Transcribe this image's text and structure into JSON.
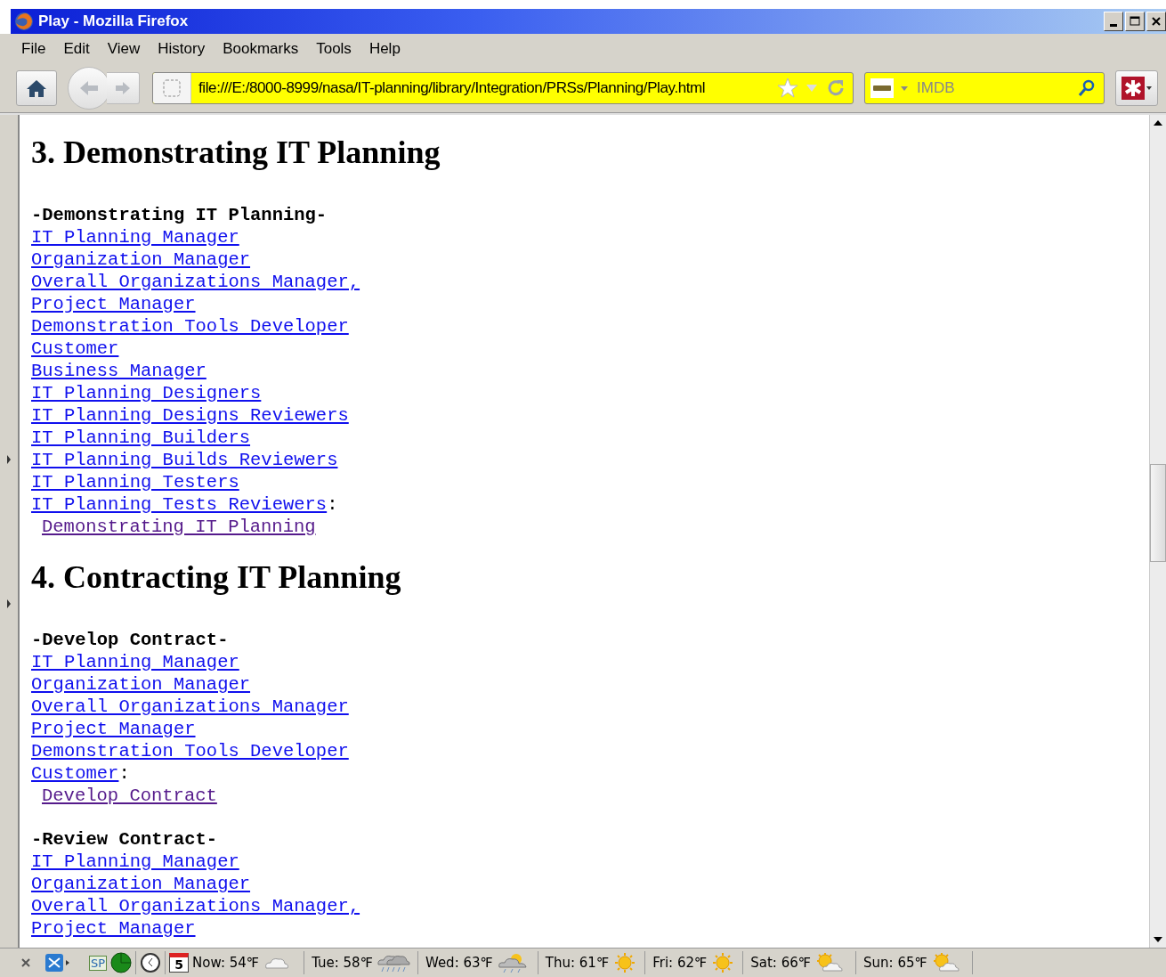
{
  "window": {
    "title": "Play - Mozilla Firefox"
  },
  "menu": [
    "File",
    "Edit",
    "View",
    "History",
    "Bookmarks",
    "Tools",
    "Help"
  ],
  "address_bar": {
    "value": "file:///E:/8000-8999/nasa/IT-planning/library/Integration/PRSs/Planning/Play.html"
  },
  "search_bar": {
    "placeholder": "IMDB"
  },
  "sections": [
    {
      "heading": "3. Demonstrating IT Planning",
      "groups": [
        {
          "title": "-Demonstrating IT Planning-",
          "roles": [
            {
              "text": "IT Planning Manager",
              "visited": false
            },
            {
              "text": "Organization Manager",
              "visited": false
            },
            {
              "text": "Overall Organizations Manager,",
              "visited": false
            },
            {
              "text": "Project Manager",
              "visited": false
            },
            {
              "text": "Demonstration Tools Developer",
              "visited": false
            },
            {
              "text": "Customer",
              "visited": false
            },
            {
              "text": "Business Manager",
              "visited": false
            },
            {
              "text": "IT Planning Designers",
              "visited": false
            },
            {
              "text": "IT Planning Designs Reviewers",
              "visited": false
            },
            {
              "text": "IT Planning Builders",
              "visited": false
            },
            {
              "text": "IT Planning Builds Reviewers",
              "visited": false
            },
            {
              "text": "IT Planning Testers",
              "visited": false
            },
            {
              "text": "IT Planning Tests Reviewers",
              "visited": false
            }
          ],
          "suffix": ":",
          "action": {
            "text": "Demonstrating IT Planning",
            "visited": true
          }
        }
      ]
    },
    {
      "heading": "4. Contracting IT Planning",
      "groups": [
        {
          "title": "-Develop Contract-",
          "roles": [
            {
              "text": "IT Planning Manager",
              "visited": false
            },
            {
              "text": "Organization Manager",
              "visited": false
            },
            {
              "text": "Overall Organizations Manager",
              "visited": false
            },
            {
              "text": "Project Manager",
              "visited": false
            },
            {
              "text": "Demonstration Tools Developer",
              "visited": false
            },
            {
              "text": "Customer",
              "visited": false
            }
          ],
          "suffix": ":",
          "action": {
            "text": "Develop Contract",
            "visited": true
          }
        },
        {
          "title": "-Review Contract-",
          "roles": [
            {
              "text": "IT Planning Manager",
              "visited": false
            },
            {
              "text": "Organization Manager",
              "visited": false
            },
            {
              "text": "Overall Organizations Manager,",
              "visited": false
            },
            {
              "text": "Project Manager",
              "visited": false
            }
          ]
        }
      ]
    }
  ],
  "status_bar": {
    "calendar_day": "5",
    "sp_label": "SP",
    "weather": [
      {
        "label": "Now: 54℉",
        "kind": "cloudy"
      },
      {
        "label": "Tue: 58℉",
        "kind": "rain"
      },
      {
        "label": "Wed: 63℉",
        "kind": "sun-rain"
      },
      {
        "label": "Thu: 61℉",
        "kind": "sunny"
      },
      {
        "label": "Fri: 62℉",
        "kind": "sunny"
      },
      {
        "label": "Sat: 66℉",
        "kind": "partly-cloudy"
      },
      {
        "label": "Sun: 65℉",
        "kind": "partly-cloudy"
      }
    ]
  }
}
